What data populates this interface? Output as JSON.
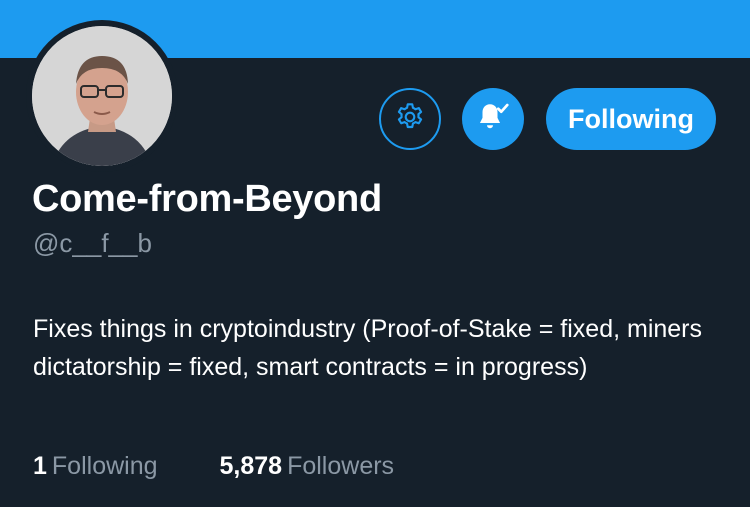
{
  "profile": {
    "display_name": "Come-from-Beyond",
    "handle": "@c__f__b",
    "bio": "Fixes things in cryptoindustry (Proof-of-Stake = fixed, miners dictatorship = fixed, smart contracts = in progress)"
  },
  "actions": {
    "settings_icon": "gear-icon",
    "notifications_icon": "bell-check-icon",
    "follow_label": "Following"
  },
  "stats": {
    "following_count": "1",
    "following_label": "Following",
    "followers_count": "5,878",
    "followers_label": "Followers"
  },
  "colors": {
    "accent": "#1d9bf0",
    "background": "#15202b",
    "muted_text": "#8b98a5"
  }
}
